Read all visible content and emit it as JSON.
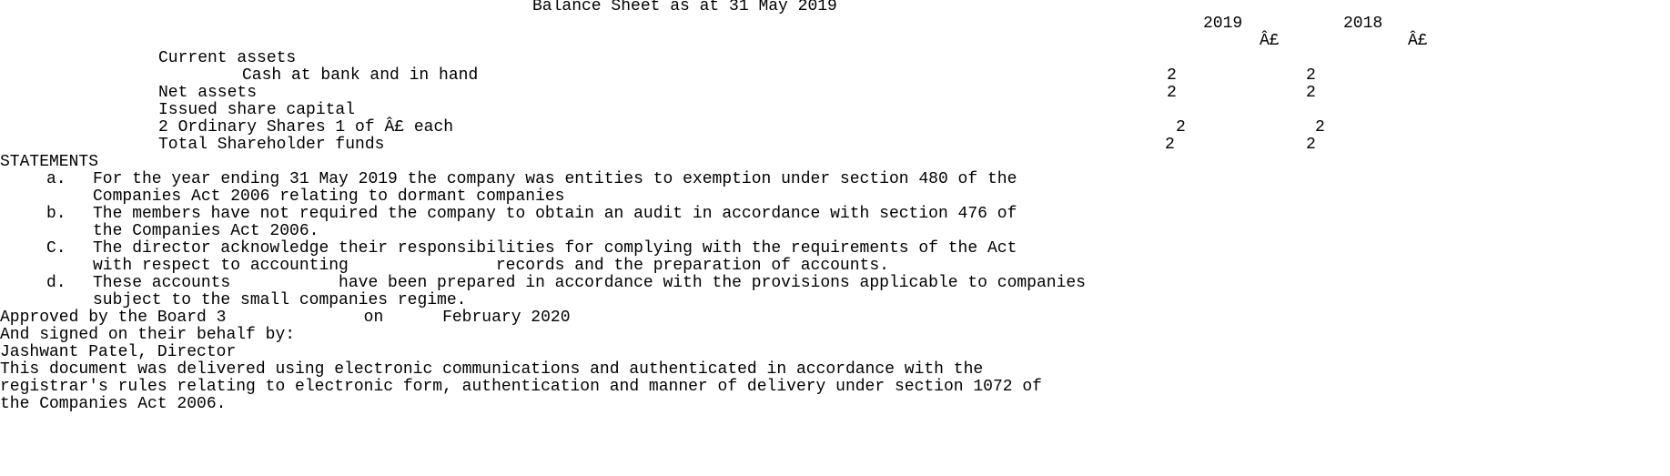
{
  "document": {
    "title": "Balance Sheet as at 31 May 2019",
    "columns": {
      "year_current": "2019",
      "year_prior": "2018",
      "currency_current": "Â£",
      "currency_prior": "Â£"
    },
    "balance_sheet": {
      "current_assets_label": "Current assets",
      "cash_label": "Cash at bank and in hand",
      "cash_2019": "2",
      "cash_2018": "2",
      "net_assets_label": "Net assets",
      "net_assets_2019": "2",
      "net_assets_2018": "2",
      "issued_share_capital_label": "Issued share capital",
      "ordinary_shares_label": "2 Ordinary Shares 1 of Â£ each",
      "ordinary_shares_2019": "2",
      "ordinary_shares_2018": "2",
      "total_shareholder_funds_label": "Total Shareholder funds",
      "total_shareholder_funds_2019": "2",
      "total_shareholder_funds_2018": "2"
    },
    "statements": {
      "heading": "STATEMENTS",
      "items": [
        {
          "marker": "a.",
          "line1": "For the year ending 31 May 2019 the company was entities to exemption under section 480 of the",
          "line2": "Companies Act 2006 relating to dormant companies"
        },
        {
          "marker": "b.",
          "line1": "The members have not required the company to obtain an audit in accordance with section 476 of",
          "line2": "the Companies Act 2006."
        },
        {
          "marker": "C.",
          "line1": "The director acknowledge their responsibilities for complying with the requirements of the Act",
          "line2": "with respect to accounting               records and the preparation of accounts."
        },
        {
          "marker": "d.",
          "line1": "These accounts           have been prepared in accordance with the provisions applicable to companies",
          "line2": "subject to the small companies regime."
        }
      ]
    },
    "approval": {
      "approved_line": "Approved by the Board 3              on      February 2020",
      "signed_line": "And signed on their behalf by:",
      "director_line": "Jashwant Patel, Director"
    },
    "footer": {
      "line1": "This document was delivered using electronic communications and authenticated in accordance with the",
      "line2": "registrar's rules relating to electronic form, authentication and manner of delivery under section 1072 of",
      "line3": "the Companies Act 2006."
    }
  }
}
